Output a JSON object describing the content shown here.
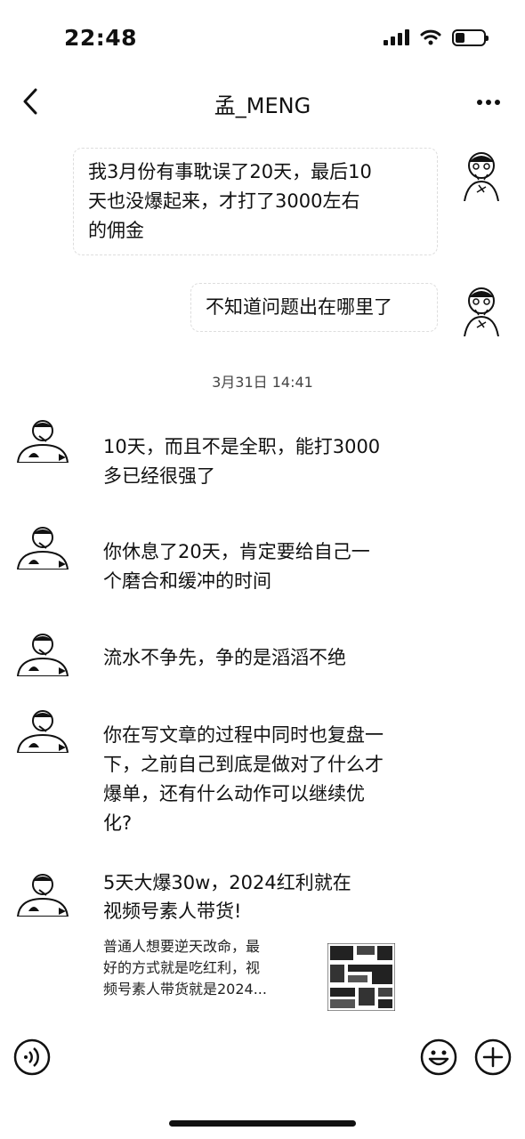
{
  "status_bar": {
    "time": "22:48",
    "icons": [
      "signal-icon",
      "wifi-icon",
      "battery-icon"
    ]
  },
  "nav": {
    "title": "孟_MENG",
    "back_icon": "chevron-left-icon",
    "more_icon": "more-horizontal-icon"
  },
  "messages_out": [
    {
      "lines": [
        "我3月份有事耽误了20天，最后10",
        "天也没爆起来，才打了3000左右",
        "的佣金"
      ]
    },
    {
      "lines": [
        "不知道问题出在哪里了"
      ]
    }
  ],
  "timestamp": "3月31日 14:41",
  "messages_in": [
    {
      "lines": [
        "10天，而且不是全职，能打3000",
        "多已经很强了"
      ]
    },
    {
      "lines": [
        "你休息了20天，肯定要给自己一",
        "个磨合和缓冲的时间"
      ]
    },
    {
      "lines": [
        "流水不争先，争的是滔滔不绝"
      ]
    },
    {
      "lines": [
        "你在写文章的过程中同时也复盘一",
        "下，之前自己到底是做对了什么才",
        "爆单，还有什么动作可以继续优",
        "化?"
      ]
    }
  ],
  "link_card": {
    "title_lines": [
      "5天大爆30w，2024红利就在",
      "视频号素人带货!"
    ],
    "desc_lines": [
      "普通人想要逆天改命，最",
      "好的方式就是吃红利，视",
      "频号素人带货就是2024..."
    ]
  },
  "input_bar": {
    "voice_icon": "voice-icon",
    "emoji_icon": "emoji-icon",
    "plus_icon": "plus-circle-icon"
  }
}
